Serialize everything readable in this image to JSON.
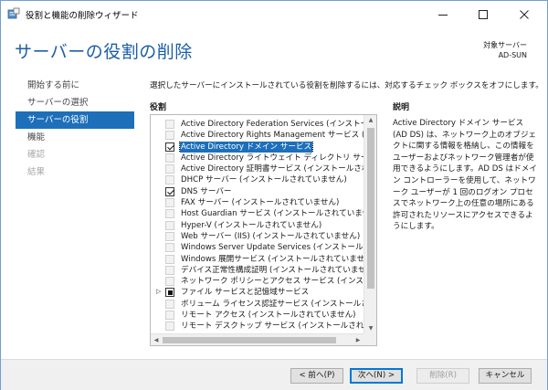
{
  "window": {
    "title": "役割と機能の削除ウィザード",
    "icon": "server-manager-icon"
  },
  "header": {
    "page_title": "サーバーの役割の削除",
    "target_label": "対象サーバー",
    "target_value": "AD-SUN"
  },
  "nav": {
    "items": [
      {
        "label": "開始する前に",
        "state": "normal"
      },
      {
        "label": "サーバーの選択",
        "state": "normal"
      },
      {
        "label": "サーバーの役割",
        "state": "current"
      },
      {
        "label": "機能",
        "state": "normal"
      },
      {
        "label": "確認",
        "state": "disabled"
      },
      {
        "label": "結果",
        "state": "disabled"
      }
    ]
  },
  "content": {
    "instruction": "選択したサーバーにインストールされている役割を削除するには、対応するチェック ボックスをオフにします。",
    "roles_label": "役割",
    "description_label": "説明",
    "description_text": "Active Directory ドメイン サービス (AD DS) は、ネットワーク上のオブジェクトに関する情報を格納し、この情報をユーザーおよびネットワーク管理者が使用できるようにします。AD DS はドメイン コントローラーを使用して、ネットワーク ユーザーが 1 回のログオン プロセスでネットワーク上の任意の場所にある許可されたリソースにアクセスできるようにします。",
    "roles": [
      {
        "label": "Active Directory Federation Services (インストールされ",
        "check": "none",
        "expander": false,
        "selected": false
      },
      {
        "label": "Active Directory Rights Management サービス (インス",
        "check": "none",
        "expander": false,
        "selected": false
      },
      {
        "label": "Active Directory ドメイン サービス",
        "check": "checked",
        "expander": false,
        "selected": true
      },
      {
        "label": "Active Directory ライトウェイト ディレクトリ サービス (イン",
        "check": "none",
        "expander": false,
        "selected": false
      },
      {
        "label": "Active Directory 証明書サービス (インストールされていま",
        "check": "none",
        "expander": false,
        "selected": false
      },
      {
        "label": "DHCP サーバー (インストールされていません)",
        "check": "none",
        "expander": false,
        "selected": false
      },
      {
        "label": "DNS サーバー",
        "check": "checked",
        "expander": false,
        "selected": false
      },
      {
        "label": "FAX サーバー (インストールされていません)",
        "check": "none",
        "expander": false,
        "selected": false
      },
      {
        "label": "Host Guardian サービス (インストールされていません)",
        "check": "none",
        "expander": false,
        "selected": false
      },
      {
        "label": "Hyper-V (インストールされていません)",
        "check": "none",
        "expander": false,
        "selected": false
      },
      {
        "label": "Web サーバー (IIS) (インストールされていません)",
        "check": "none",
        "expander": false,
        "selected": false
      },
      {
        "label": "Windows Server Update Services (インストールされてい",
        "check": "none",
        "expander": false,
        "selected": false
      },
      {
        "label": "Windows 展開サービス (インストールされていません)",
        "check": "none",
        "expander": false,
        "selected": false
      },
      {
        "label": "デバイス正常性構成証明 (インストールされていません)",
        "check": "none",
        "expander": false,
        "selected": false
      },
      {
        "label": "ネットワーク ポリシーとアクセス サービス (インストールされて",
        "check": "none",
        "expander": false,
        "selected": false
      },
      {
        "label": "ファイル サービスと記憶域サービス",
        "check": "partial",
        "expander": true,
        "selected": false
      },
      {
        "label": "ボリューム ライセンス認証サービス (インストールされていませ",
        "check": "none",
        "expander": false,
        "selected": false
      },
      {
        "label": "リモート アクセス (インストールされていません)",
        "check": "none",
        "expander": false,
        "selected": false
      },
      {
        "label": "リモート デスクトップ サービス (インストールされていません)",
        "check": "none",
        "expander": false,
        "selected": false
      }
    ]
  },
  "footer": {
    "back_label": "< 前へ(P)",
    "next_label": "次へ(N) >",
    "remove_label": "削除(R)",
    "cancel_label": "キャンセル"
  },
  "colors": {
    "accent": "#1d6fba",
    "title_blue": "#1c5fa8",
    "window_border": "#6e9fd6"
  }
}
